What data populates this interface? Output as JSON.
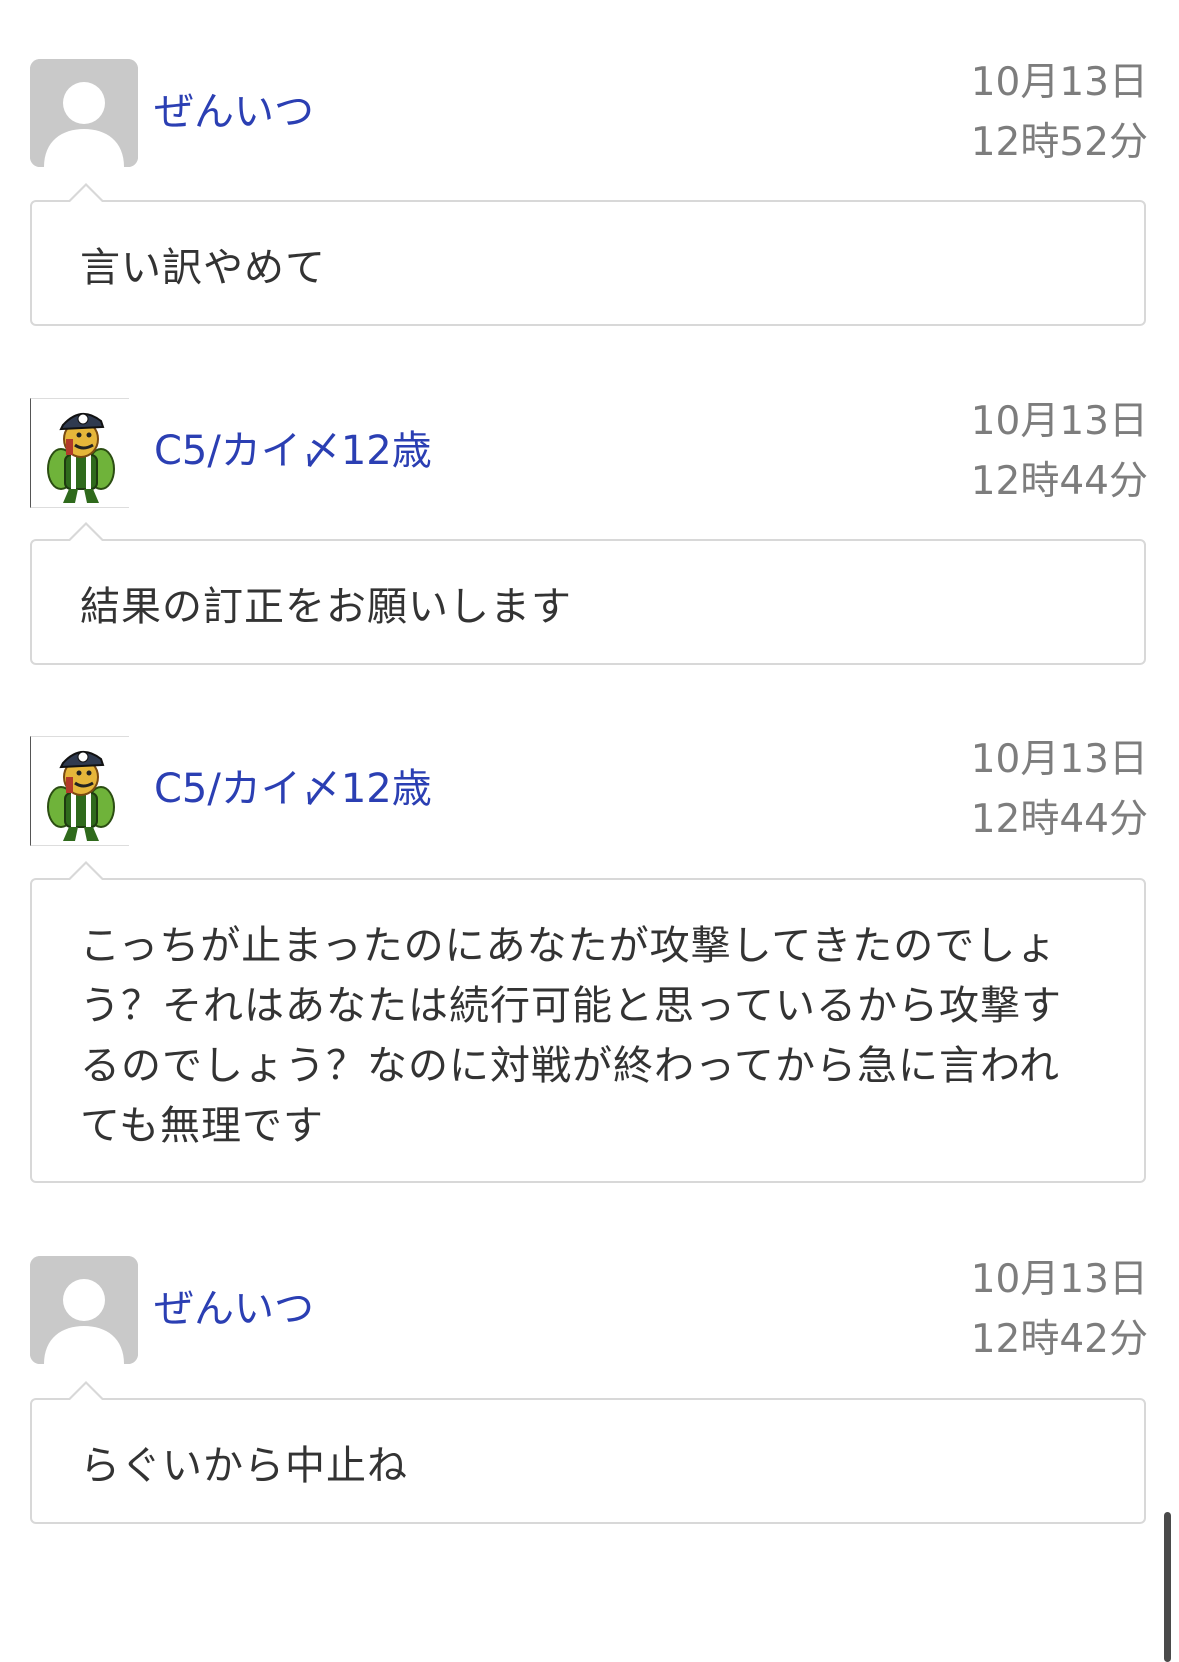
{
  "comments": [
    {
      "avatar": "default-user-icon",
      "username": "ぜんいつ",
      "date": "10月13日",
      "time": "12時52分",
      "text": "言い訳やめて"
    },
    {
      "avatar": "character-avatar",
      "username": "C5/カイ〆12歳",
      "date": "10月13日",
      "time": "12時44分",
      "text": "結果の訂正をお願いします"
    },
    {
      "avatar": "character-avatar",
      "username": "C5/カイ〆12歳",
      "date": "10月13日",
      "time": "12時44分",
      "text": "こっちが止まったのにあなたが攻撃してきたのでしょう？それはあなたは続行可能と思っているから攻撃するのでしょう？なのに対戦が終わってから急に言われても無理です"
    },
    {
      "avatar": "default-user-icon",
      "username": "ぜんいつ",
      "date": "10月13日",
      "time": "12時42分",
      "text": "らぐいから中止ね"
    }
  ],
  "colors": {
    "username": "#2b3fb3",
    "timestamp": "#7d7d7d",
    "text": "#333333",
    "border": "#d8d8d8",
    "avatar_bg": "#c9c9c9"
  }
}
